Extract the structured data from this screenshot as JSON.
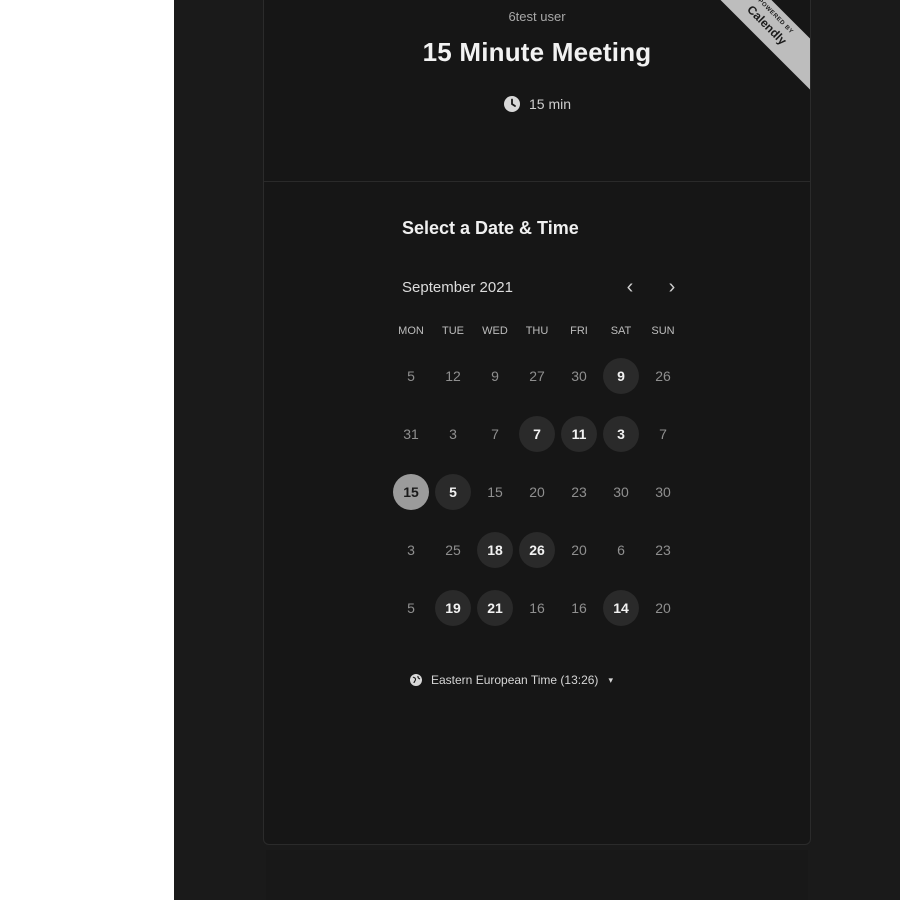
{
  "header": {
    "organizer": "6test user",
    "event_title": "15 Minute Meeting",
    "duration": "15 min",
    "ribbon_small": "POWERED BY",
    "ribbon_brand": "Calendly",
    "icons": {
      "duration": "clock-icon"
    }
  },
  "scheduler": {
    "title": "Select a Date & Time",
    "month": "September 2021",
    "nav": {
      "prev_icon": "chevron-left-icon",
      "prev": "‹",
      "next_icon": "chevron-right-icon",
      "next": "›"
    },
    "weekdays": [
      "MON",
      "TUE",
      "WED",
      "THU",
      "FRI",
      "SAT",
      "SUN"
    ],
    "weeks": [
      [
        {
          "day": "5",
          "state": "unavailable"
        },
        {
          "day": "12",
          "state": "unavailable"
        },
        {
          "day": "9",
          "state": "unavailable"
        },
        {
          "day": "27",
          "state": "unavailable"
        },
        {
          "day": "30",
          "state": "unavailable"
        },
        {
          "day": "9",
          "state": "available"
        },
        {
          "day": "26",
          "state": "unavailable"
        }
      ],
      [
        {
          "day": "31",
          "state": "unavailable"
        },
        {
          "day": "3",
          "state": "unavailable"
        },
        {
          "day": "7",
          "state": "unavailable"
        },
        {
          "day": "7",
          "state": "available"
        },
        {
          "day": "11",
          "state": "available"
        },
        {
          "day": "3",
          "state": "available"
        },
        {
          "day": "7",
          "state": "unavailable"
        }
      ],
      [
        {
          "day": "15",
          "state": "selected"
        },
        {
          "day": "5",
          "state": "available"
        },
        {
          "day": "15",
          "state": "unavailable"
        },
        {
          "day": "20",
          "state": "unavailable"
        },
        {
          "day": "23",
          "state": "unavailable"
        },
        {
          "day": "30",
          "state": "unavailable"
        },
        {
          "day": "30",
          "state": "unavailable"
        }
      ],
      [
        {
          "day": "3",
          "state": "unavailable"
        },
        {
          "day": "25",
          "state": "unavailable"
        },
        {
          "day": "18",
          "state": "available"
        },
        {
          "day": "26",
          "state": "available"
        },
        {
          "day": "20",
          "state": "unavailable"
        },
        {
          "day": "6",
          "state": "unavailable"
        },
        {
          "day": "23",
          "state": "unavailable"
        }
      ],
      [
        {
          "day": "5",
          "state": "unavailable"
        },
        {
          "day": "19",
          "state": "available"
        },
        {
          "day": "21",
          "state": "available"
        },
        {
          "day": "16",
          "state": "unavailable"
        },
        {
          "day": "16",
          "state": "unavailable"
        },
        {
          "day": "14",
          "state": "available"
        },
        {
          "day": "20",
          "state": "unavailable"
        }
      ]
    ],
    "timezone": {
      "label": "Eastern European Time (13:26)",
      "icon": "globe-icon",
      "caret": "▾"
    }
  },
  "colors": {
    "background": "#1a1a1a",
    "card": "#161616",
    "available_day": "#2a2a2a",
    "selected_day": "#9b9b9b",
    "ribbon": "#bdbdbd"
  }
}
